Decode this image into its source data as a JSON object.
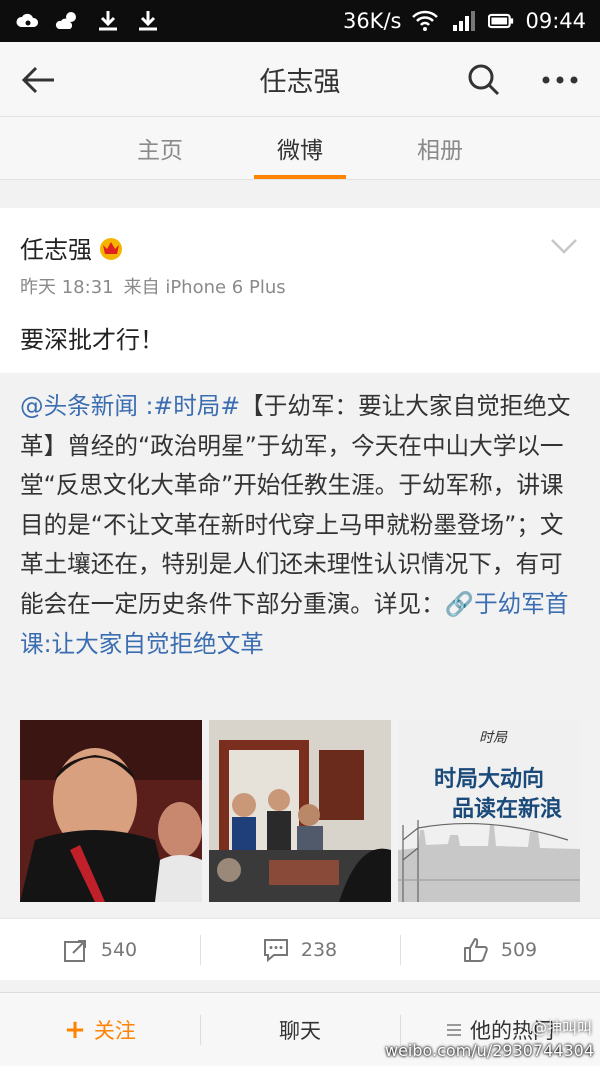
{
  "status_bar": {
    "network_speed": "36K/s",
    "time": "09:44"
  },
  "nav": {
    "title": "任志强"
  },
  "tabs": [
    {
      "label": "主页"
    },
    {
      "label": "微博"
    },
    {
      "label": "相册"
    }
  ],
  "post": {
    "author": "任志强",
    "time": "昨天 18:31",
    "source": "来自 iPhone 6 Plus",
    "text": "要深批才行！",
    "repost": {
      "mention": "@头条新闻",
      "sep": " :",
      "hashtag": "#时局#",
      "body": "【于幼军：要让大家自觉拒绝文革】曾经的“政治明星”于幼军，今天在中山大学以一堂“反思文化大革命”开始任教生涯。于幼军称，讲课目的是“不让文革在新时代穿上马甲就粉墨登场”；文革土壤还在，特别是人们还未理性认识情况下，有可能会在一定历史条件下部分重演。详见：",
      "link_text": "于幼军首课:让大家自觉拒绝文革",
      "image3_text_1": "时局大动向",
      "image3_text_2": "品读在新浪"
    }
  },
  "actions": {
    "repost_count": "540",
    "comment_count": "238",
    "like_count": "509"
  },
  "bottom_bar": {
    "follow": "关注",
    "chat": "聊天",
    "hot": "他的热门"
  },
  "watermark": {
    "line1": "@抻叫叫",
    "line2": "weibo.com/u/2930744304"
  },
  "colors": {
    "accent": "#ff8200",
    "link": "#3b6db1"
  }
}
